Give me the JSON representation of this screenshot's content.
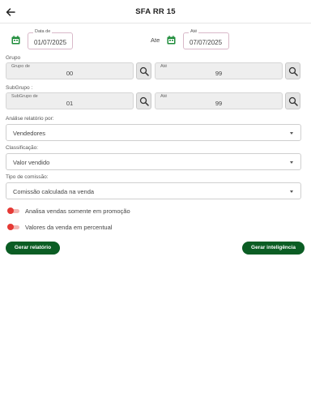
{
  "header": {
    "title": "SFA RR 15",
    "back_icon": "arrow-left-icon"
  },
  "date_range": {
    "from_label": "Data de",
    "from_value": "01/07/2025",
    "separator": "Ate",
    "to_label": "Até",
    "to_value": "07/07/2025"
  },
  "grupo": {
    "section_label": "Grupo",
    "from_label": "Grupo de",
    "from_value": "00",
    "to_label": "Até",
    "to_value": "99"
  },
  "subgrupo": {
    "section_label": "SubGrupo :",
    "from_label": "SubGrupo de",
    "from_value": "01",
    "to_label": "Até",
    "to_value": "99"
  },
  "analise": {
    "label": "Análise relatório por:",
    "value": "Vendedores"
  },
  "classificacao": {
    "label": "Classificação:",
    "value": "Valor vendido"
  },
  "tipo_comissao": {
    "label": "Tipo de comissão:",
    "value": "Comissão calculada na venda"
  },
  "toggles": [
    {
      "label": "Analisa vendas somente em promoção",
      "on": false
    },
    {
      "label": "Valores da venda em percentual",
      "on": false
    }
  ],
  "buttons": {
    "report": "Gerar relatório",
    "intelligence": "Gerar inteligência"
  },
  "colors": {
    "primary": "#0b5d24",
    "accent_red": "#e53935",
    "calendar_green": "#1e8c3a"
  }
}
